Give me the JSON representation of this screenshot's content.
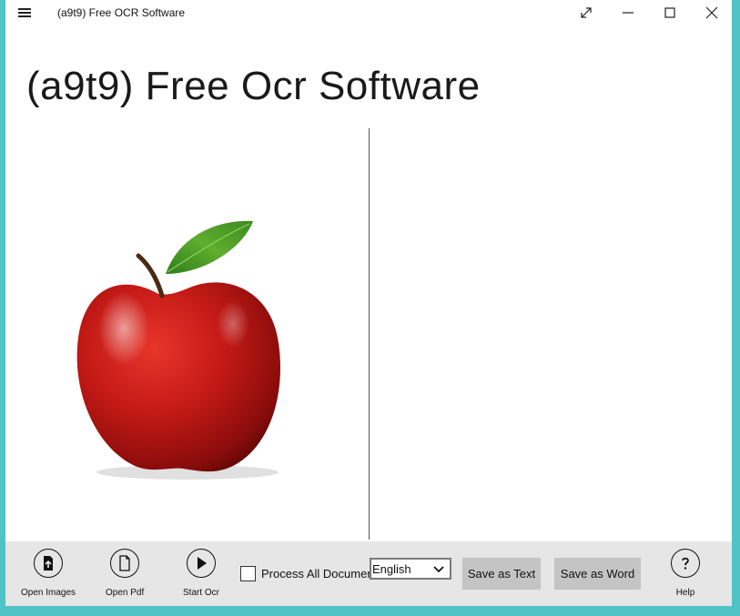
{
  "window": {
    "title": "(a9t9) Free OCR Software"
  },
  "app": {
    "title": "(a9t9) Free Ocr Software"
  },
  "commandbar": {
    "open_images": {
      "label": "Open Images",
      "icon": "file-upload-icon"
    },
    "open_pdf": {
      "label": "Open Pdf",
      "icon": "document-icon"
    },
    "start_ocr": {
      "label": "Start Ocr",
      "icon": "play-icon"
    },
    "process_all": {
      "label": "Process All Documents",
      "checked": false
    },
    "language": {
      "selected": "English"
    },
    "save_text": "Save as Text",
    "save_word": "Save as Word",
    "help": {
      "label": "Help",
      "icon": "help-icon"
    }
  },
  "colors": {
    "frame": "#4fc3c6",
    "commandbar": "#e6e6e6",
    "button": "#c4c4c4"
  }
}
